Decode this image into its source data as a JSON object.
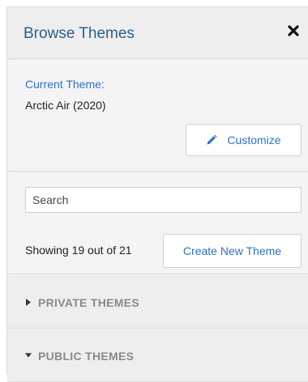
{
  "header": {
    "title": "Browse Themes",
    "close_icon": "close-icon"
  },
  "current_theme": {
    "label": "Current Theme:",
    "value": "Arctic Air (2020)",
    "customize_label": "Customize",
    "customize_icon": "pencil-icon"
  },
  "browser": {
    "search_placeholder": "Search",
    "showing_text": "Showing 19 out of 21",
    "create_label": "Create New Theme"
  },
  "groups": [
    {
      "label": "PRIVATE THEMES",
      "expanded": false
    },
    {
      "label": "PUBLIC THEMES",
      "expanded": true
    }
  ],
  "colors": {
    "link_blue": "#2f73c4",
    "title_blue": "#2c5f8c",
    "muted_gray": "#8a8a8a"
  }
}
